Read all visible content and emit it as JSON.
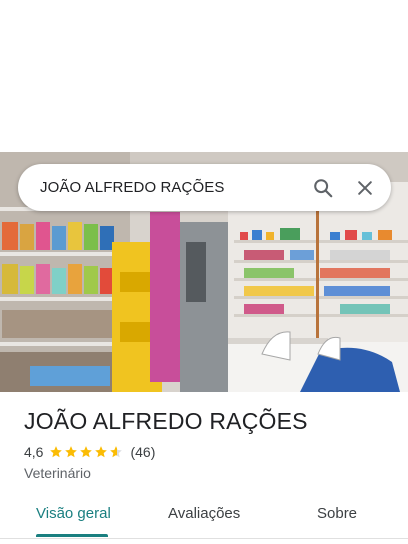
{
  "search": {
    "query": "JOÃO ALFREDO RAÇÕES"
  },
  "place": {
    "name": "JOÃO ALFREDO RAÇÕES",
    "rating": "4,6",
    "stars": 4.6,
    "reviews_count": "(46)",
    "category": "Veterinário"
  },
  "tabs": [
    {
      "label": "Visão geral",
      "active": true
    },
    {
      "label": "Avaliações",
      "active": false
    },
    {
      "label": "Sobre",
      "active": false
    }
  ],
  "colors": {
    "accent": "#1a7f80",
    "star": "#fbbc04",
    "text": "#202124"
  },
  "icons": [
    "search-icon",
    "close-icon",
    "star-icon"
  ]
}
